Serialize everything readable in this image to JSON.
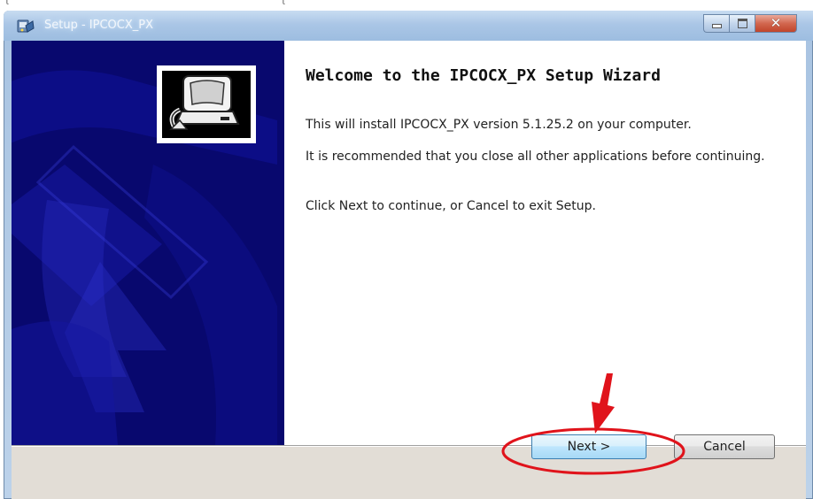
{
  "page_top": {
    "glyphs": "ι",
    "paren_text": "ι"
  },
  "window": {
    "title": "Setup - IPCOCX_PX",
    "icons": {
      "app": "setup-app-icon",
      "minimize": "minimize-icon",
      "maximize": "maximize-icon",
      "close": "close-icon",
      "wizard": "computer-install-icon"
    },
    "close_glyph": "✕"
  },
  "wizard": {
    "heading": "Welcome to the IPCOCX_PX Setup Wizard",
    "paragraphs": [
      "This will install IPCOCX_PX version 5.1.25.2 on your computer.",
      "It is recommended that you close all other applications before continuing.",
      "Click Next to continue, or Cancel to exit Setup."
    ]
  },
  "buttons": {
    "next": "Next >",
    "cancel": "Cancel"
  },
  "annotation": {
    "color": "#e0131b",
    "highlights": "next-button"
  },
  "colors": {
    "side_panel": "#08086e",
    "footer": "#e2ddd6"
  }
}
